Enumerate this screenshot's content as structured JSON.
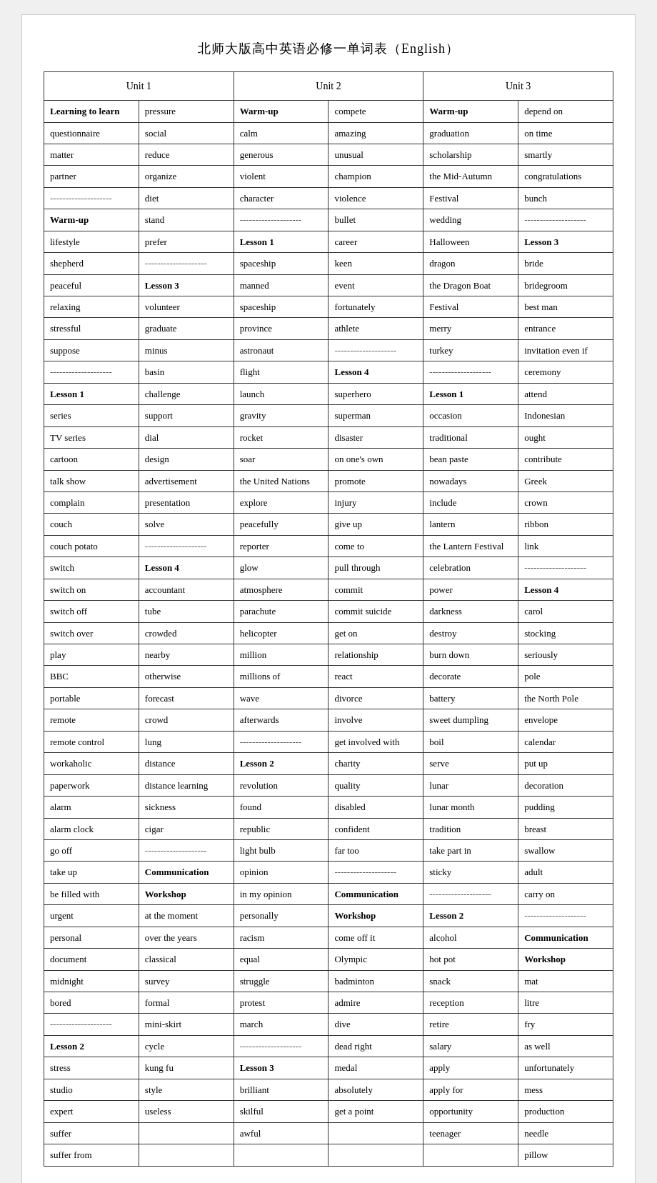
{
  "title": "北师大版高中英语必修一单词表（English）",
  "units": [
    {
      "header": "Unit 1",
      "col1": [
        {
          "text": "Learning to learn",
          "bold": true
        },
        {
          "text": "questionnaire"
        },
        {
          "text": "matter"
        },
        {
          "text": "partner"
        },
        {
          "text": "--------------------",
          "divider": true
        },
        {
          "text": "Warm-up",
          "bold": true
        },
        {
          "text": "lifestyle"
        },
        {
          "text": "shepherd"
        },
        {
          "text": "peaceful"
        },
        {
          "text": "relaxing"
        },
        {
          "text": "stressful"
        },
        {
          "text": "suppose"
        },
        {
          "text": "--------------------",
          "divider": true
        },
        {
          "text": "Lesson 1",
          "bold": true
        },
        {
          "text": "series"
        },
        {
          "text": "TV series"
        },
        {
          "text": "cartoon"
        },
        {
          "text": "talk show"
        },
        {
          "text": "complain"
        },
        {
          "text": "couch"
        },
        {
          "text": "couch potato"
        },
        {
          "text": "switch"
        },
        {
          "text": "switch on"
        },
        {
          "text": "switch off"
        },
        {
          "text": "switch over"
        },
        {
          "text": "play"
        },
        {
          "text": "BBC"
        },
        {
          "text": "portable"
        },
        {
          "text": "remote"
        },
        {
          "text": "remote control"
        },
        {
          "text": "workaholic"
        },
        {
          "text": "paperwork"
        },
        {
          "text": "alarm"
        },
        {
          "text": "alarm clock"
        },
        {
          "text": "go off"
        },
        {
          "text": "take up"
        },
        {
          "text": "be filled with"
        },
        {
          "text": "urgent"
        },
        {
          "text": "personal"
        },
        {
          "text": "document"
        },
        {
          "text": "midnight"
        },
        {
          "text": "bored"
        },
        {
          "text": "--------------------",
          "divider": true
        },
        {
          "text": "Lesson 2",
          "bold": true
        },
        {
          "text": "stress"
        },
        {
          "text": "studio"
        },
        {
          "text": "expert"
        },
        {
          "text": "suffer"
        },
        {
          "text": "suffer from"
        }
      ],
      "col2": [
        {
          "text": "pressure"
        },
        {
          "text": "social"
        },
        {
          "text": "reduce"
        },
        {
          "text": "organize"
        },
        {
          "text": "diet"
        },
        {
          "text": "stand"
        },
        {
          "text": "prefer"
        },
        {
          "text": "--------------------",
          "divider": true
        },
        {
          "text": "Lesson 3",
          "bold": true
        },
        {
          "text": "volunteer"
        },
        {
          "text": "graduate"
        },
        {
          "text": "minus"
        },
        {
          "text": "basin"
        },
        {
          "text": "challenge"
        },
        {
          "text": "support"
        },
        {
          "text": "dial"
        },
        {
          "text": "design"
        },
        {
          "text": "advertisement"
        },
        {
          "text": "presentation"
        },
        {
          "text": "solve"
        },
        {
          "text": "--------------------",
          "divider": true
        },
        {
          "text": "Lesson 4",
          "bold": true
        },
        {
          "text": "accountant"
        },
        {
          "text": "tube"
        },
        {
          "text": "crowded"
        },
        {
          "text": "nearby"
        },
        {
          "text": "otherwise"
        },
        {
          "text": "forecast"
        },
        {
          "text": "crowd"
        },
        {
          "text": "lung"
        },
        {
          "text": "distance"
        },
        {
          "text": "distance learning"
        },
        {
          "text": "sickness"
        },
        {
          "text": "cigar"
        },
        {
          "text": "--------------------",
          "divider": true
        },
        {
          "text": "Communication",
          "bold": true
        },
        {
          "text": "Workshop",
          "bold": true
        },
        {
          "text": "at the moment"
        },
        {
          "text": "over the years"
        },
        {
          "text": "classical"
        },
        {
          "text": "survey"
        },
        {
          "text": "formal"
        },
        {
          "text": "mini-skirt"
        },
        {
          "text": "cycle"
        },
        {
          "text": "kung fu"
        },
        {
          "text": "style"
        },
        {
          "text": "useless"
        }
      ]
    },
    {
      "header": "Unit 2",
      "col1": [
        {
          "text": "Warm-up",
          "bold": true
        },
        {
          "text": "calm"
        },
        {
          "text": "generous"
        },
        {
          "text": "violent"
        },
        {
          "text": "character"
        },
        {
          "text": "--------------------",
          "divider": true
        },
        {
          "text": "Lesson 1",
          "bold": true
        },
        {
          "text": "spaceship"
        },
        {
          "text": "manned"
        },
        {
          "text": "spaceship"
        },
        {
          "text": "province"
        },
        {
          "text": "astronaut"
        },
        {
          "text": "flight"
        },
        {
          "text": "launch"
        },
        {
          "text": "gravity"
        },
        {
          "text": "rocket"
        },
        {
          "text": "soar"
        },
        {
          "text": "the United Nations"
        },
        {
          "text": "explore"
        },
        {
          "text": "peacefully"
        },
        {
          "text": "reporter"
        },
        {
          "text": "glow"
        },
        {
          "text": "atmosphere"
        },
        {
          "text": "parachute"
        },
        {
          "text": "helicopter"
        },
        {
          "text": "million"
        },
        {
          "text": "millions of"
        },
        {
          "text": "wave"
        },
        {
          "text": "afterwards"
        },
        {
          "text": "--------------------",
          "divider": true
        },
        {
          "text": "Lesson 2",
          "bold": true
        },
        {
          "text": "revolution"
        },
        {
          "text": "found"
        },
        {
          "text": "republic"
        },
        {
          "text": "light bulb"
        },
        {
          "text": "opinion"
        },
        {
          "text": "in my opinion"
        },
        {
          "text": "personally"
        },
        {
          "text": "racism"
        },
        {
          "text": "equal"
        },
        {
          "text": "struggle"
        },
        {
          "text": "protest"
        },
        {
          "text": "march"
        },
        {
          "text": "--------------------",
          "divider": true
        },
        {
          "text": "Lesson 3",
          "bold": true
        },
        {
          "text": "brilliant"
        },
        {
          "text": "skilful"
        },
        {
          "text": "awful"
        }
      ],
      "col2": [
        {
          "text": "compete"
        },
        {
          "text": "amazing"
        },
        {
          "text": "unusual"
        },
        {
          "text": "champion"
        },
        {
          "text": "violence"
        },
        {
          "text": "bullet"
        },
        {
          "text": "career"
        },
        {
          "text": "keen"
        },
        {
          "text": "event"
        },
        {
          "text": "fortunately"
        },
        {
          "text": "athlete"
        },
        {
          "text": "--------------------",
          "divider": true
        },
        {
          "text": "Lesson 4",
          "bold": true
        },
        {
          "text": "superhero"
        },
        {
          "text": "superman"
        },
        {
          "text": "disaster"
        },
        {
          "text": "on one's own"
        },
        {
          "text": "promote"
        },
        {
          "text": "injury"
        },
        {
          "text": "give up"
        },
        {
          "text": "come to"
        },
        {
          "text": "pull through"
        },
        {
          "text": "commit"
        },
        {
          "text": "commit suicide"
        },
        {
          "text": "get on"
        },
        {
          "text": "relationship"
        },
        {
          "text": "react"
        },
        {
          "text": "divorce"
        },
        {
          "text": "involve"
        },
        {
          "text": "get involved with"
        },
        {
          "text": "charity"
        },
        {
          "text": "quality"
        },
        {
          "text": "disabled"
        },
        {
          "text": "confident"
        },
        {
          "text": "far too"
        },
        {
          "text": "--------------------",
          "divider": true
        },
        {
          "text": "Communication",
          "bold": true
        },
        {
          "text": "Workshop",
          "bold": true
        },
        {
          "text": "come off it"
        },
        {
          "text": "Olympic"
        },
        {
          "text": "badminton"
        },
        {
          "text": "admire"
        },
        {
          "text": "dive"
        },
        {
          "text": "dead right"
        },
        {
          "text": "medal"
        },
        {
          "text": "absolutely"
        },
        {
          "text": "get a point"
        }
      ]
    },
    {
      "header": "Unit 3",
      "col1": [
        {
          "text": "Warm-up",
          "bold": true
        },
        {
          "text": "graduation"
        },
        {
          "text": "scholarship"
        },
        {
          "text": "the  Mid-Autumn"
        },
        {
          "text": "Festival"
        },
        {
          "text": "wedding"
        },
        {
          "text": "Halloween"
        },
        {
          "text": "dragon"
        },
        {
          "text": "the Dragon Boat"
        },
        {
          "text": "Festival"
        },
        {
          "text": "merry"
        },
        {
          "text": "turkey"
        },
        {
          "text": "--------------------",
          "divider": true
        },
        {
          "text": "Lesson 1",
          "bold": true
        },
        {
          "text": "occasion"
        },
        {
          "text": "traditional"
        },
        {
          "text": "bean paste"
        },
        {
          "text": "nowadays"
        },
        {
          "text": "include"
        },
        {
          "text": "lantern"
        },
        {
          "text": "the Lantern Festival"
        },
        {
          "text": "celebration"
        },
        {
          "text": "power"
        },
        {
          "text": "darkness"
        },
        {
          "text": "destroy"
        },
        {
          "text": "burn down"
        },
        {
          "text": "decorate"
        },
        {
          "text": "battery"
        },
        {
          "text": "sweet dumpling"
        },
        {
          "text": "boil"
        },
        {
          "text": "serve"
        },
        {
          "text": "lunar"
        },
        {
          "text": "lunar month"
        },
        {
          "text": "tradition"
        },
        {
          "text": "take part in"
        },
        {
          "text": "sticky"
        },
        {
          "text": "--------------------",
          "divider": true
        },
        {
          "text": "Lesson 2",
          "bold": true
        },
        {
          "text": "alcohol"
        },
        {
          "text": "hot pot"
        },
        {
          "text": "snack"
        },
        {
          "text": "reception"
        },
        {
          "text": "retire"
        },
        {
          "text": "salary"
        },
        {
          "text": "apply"
        },
        {
          "text": "apply for"
        },
        {
          "text": "opportunity"
        },
        {
          "text": "teenager"
        }
      ],
      "col2": [
        {
          "text": "depend on"
        },
        {
          "text": "on time"
        },
        {
          "text": "smartly"
        },
        {
          "text": "congratulations"
        },
        {
          "text": "bunch"
        },
        {
          "text": "--------------------",
          "divider": true
        },
        {
          "text": "Lesson 3",
          "bold": true
        },
        {
          "text": "bride"
        },
        {
          "text": "bridegroom"
        },
        {
          "text": "best man"
        },
        {
          "text": "entrance"
        },
        {
          "text": "invitation even if"
        },
        {
          "text": "ceremony"
        },
        {
          "text": "attend"
        },
        {
          "text": "Indonesian"
        },
        {
          "text": "ought"
        },
        {
          "text": "contribute"
        },
        {
          "text": "Greek"
        },
        {
          "text": "crown"
        },
        {
          "text": "ribbon"
        },
        {
          "text": "link"
        },
        {
          "text": "--------------------",
          "divider": true
        },
        {
          "text": "Lesson 4",
          "bold": true
        },
        {
          "text": "carol"
        },
        {
          "text": "stocking"
        },
        {
          "text": "seriously"
        },
        {
          "text": "pole"
        },
        {
          "text": "the North Pole"
        },
        {
          "text": "envelope"
        },
        {
          "text": "calendar"
        },
        {
          "text": "put up"
        },
        {
          "text": "decoration"
        },
        {
          "text": "pudding"
        },
        {
          "text": "breast"
        },
        {
          "text": "swallow"
        },
        {
          "text": "adult"
        },
        {
          "text": "carry on"
        },
        {
          "text": "--------------------",
          "divider": true
        },
        {
          "text": "Communication",
          "bold": true
        },
        {
          "text": "Workshop",
          "bold": true
        },
        {
          "text": "mat"
        },
        {
          "text": "litre"
        },
        {
          "text": "fry"
        },
        {
          "text": "as well"
        },
        {
          "text": "unfortunately"
        },
        {
          "text": "mess"
        },
        {
          "text": "production"
        },
        {
          "text": "needle"
        },
        {
          "text": "pillow"
        }
      ]
    }
  ]
}
